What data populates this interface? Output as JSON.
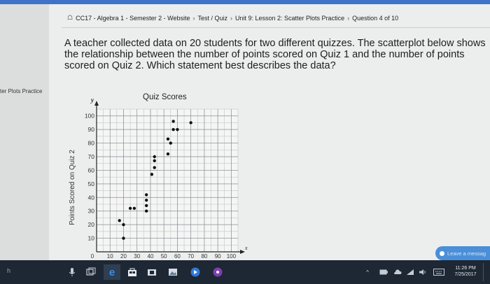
{
  "breadcrumb": {
    "items": [
      "CC17 - Algebra 1 - Semester 2 - Website",
      "Test / Quiz",
      "Unit 9: Lesson 2: Scatter Plots Practice",
      "Question 4 of 10"
    ],
    "separator": "›"
  },
  "sidebar": {
    "partial_label": "ter Plots Practice"
  },
  "question": {
    "text": "A teacher collected data on 20 students for two different quizzes. The scatterplot below shows the relationship between the number of points scored on Quiz 1 and the number of points scored on Quiz 2. Which statement best describes the data?"
  },
  "chat": {
    "label": "Leave a messag"
  },
  "taskbar": {
    "time": "11:26 PM",
    "date": "7/25/2017",
    "left_text": "h"
  },
  "chart_data": {
    "type": "scatter",
    "title": "Quiz Scores",
    "xlabel": "",
    "ylabel": "Points Scored on Quiz 2",
    "x_axis_letter": "x",
    "y_axis_letter": "y",
    "xlim": [
      0,
      105
    ],
    "ylim": [
      0,
      105
    ],
    "x_ticks": [
      10,
      20,
      30,
      40,
      50,
      60,
      70,
      80,
      90,
      100
    ],
    "y_ticks": [
      10,
      20,
      30,
      40,
      50,
      60,
      70,
      80,
      90,
      100
    ],
    "origin_label": "0",
    "grid": true,
    "points": [
      {
        "x": 20,
        "y": 10
      },
      {
        "x": 20,
        "y": 20
      },
      {
        "x": 17,
        "y": 23
      },
      {
        "x": 25,
        "y": 32
      },
      {
        "x": 28,
        "y": 32
      },
      {
        "x": 37,
        "y": 30
      },
      {
        "x": 37,
        "y": 34
      },
      {
        "x": 37,
        "y": 38
      },
      {
        "x": 37,
        "y": 42
      },
      {
        "x": 41,
        "y": 57
      },
      {
        "x": 43,
        "y": 62
      },
      {
        "x": 43,
        "y": 67
      },
      {
        "x": 43,
        "y": 70
      },
      {
        "x": 53,
        "y": 72
      },
      {
        "x": 55,
        "y": 80
      },
      {
        "x": 53,
        "y": 83
      },
      {
        "x": 57,
        "y": 90
      },
      {
        "x": 60,
        "y": 90
      },
      {
        "x": 57,
        "y": 96
      },
      {
        "x": 70,
        "y": 95
      }
    ]
  }
}
